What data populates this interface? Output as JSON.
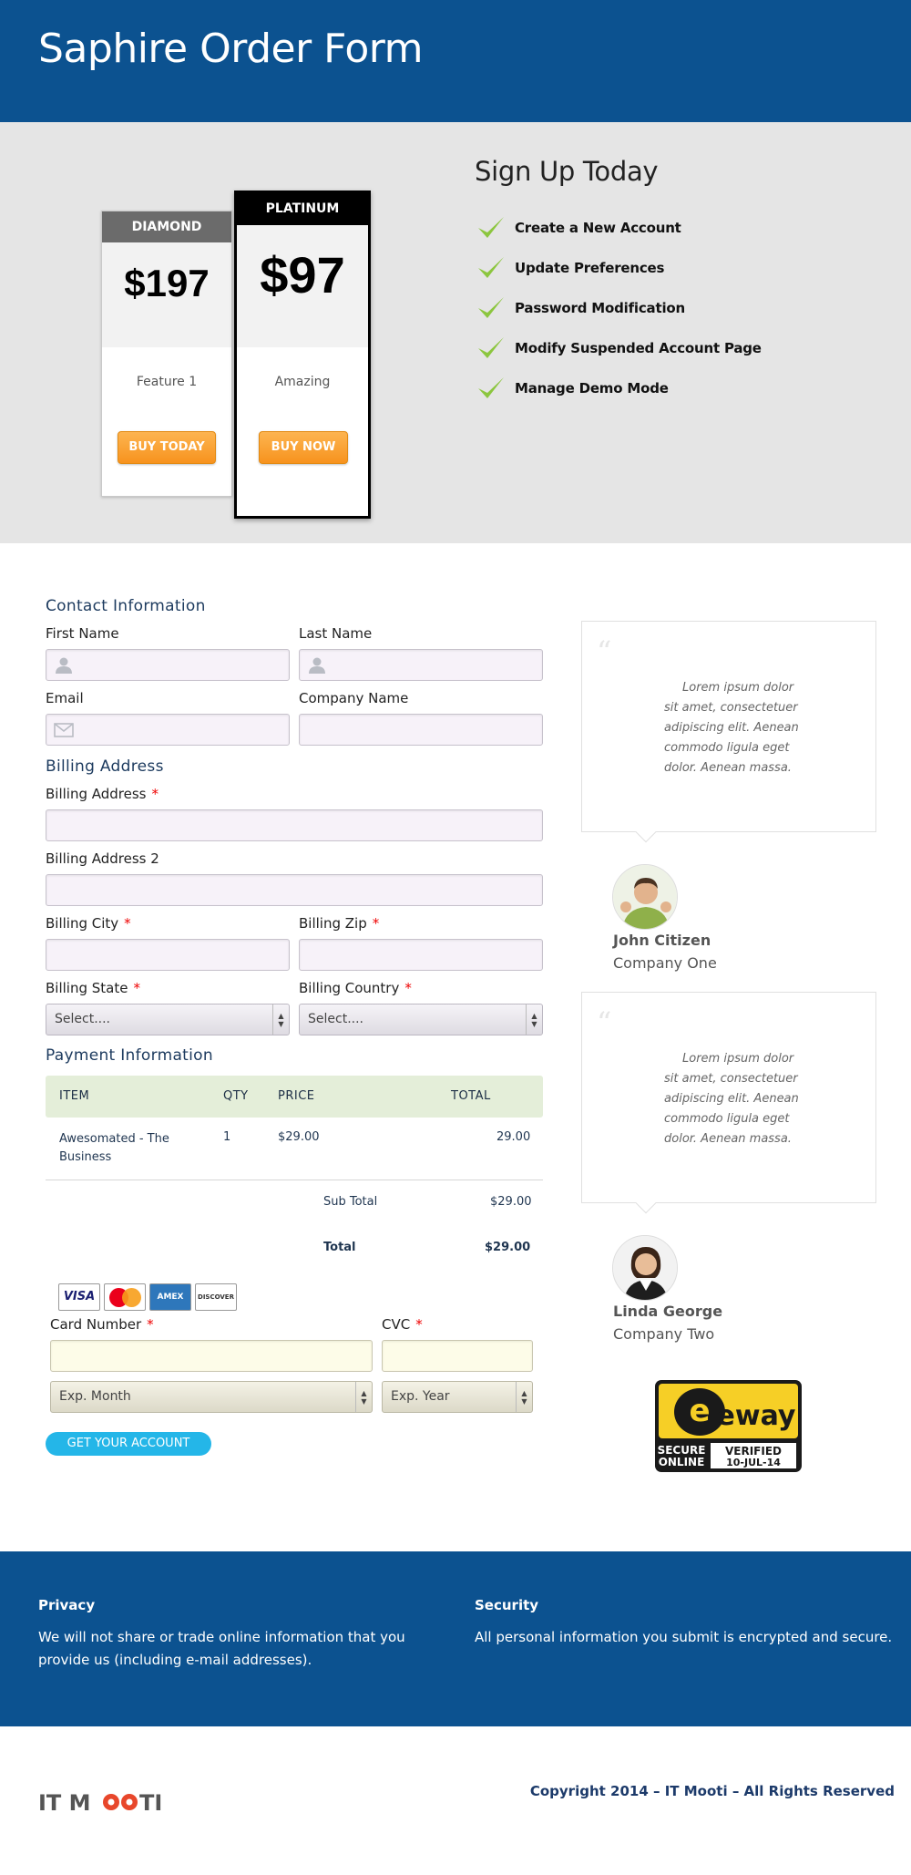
{
  "header": {
    "title": "Saphire Order Form"
  },
  "plans": [
    {
      "name": "DIAMOND",
      "price": "$197",
      "feature": "Feature 1",
      "button": "BUY TODAY"
    },
    {
      "name": "PLATINUM",
      "price": "$97",
      "feature": "Amazing",
      "button": "BUY NOW"
    }
  ],
  "signup": {
    "title": "Sign Up Today",
    "items": [
      "Create a New Account",
      "Update Preferences",
      "Password Modification",
      "Modify Suspended Account Page",
      "Manage Demo Mode"
    ]
  },
  "contact": {
    "title": "Contact Information",
    "first_name_label": "First Name",
    "last_name_label": "Last Name",
    "email_label": "Email",
    "company_label": "Company Name"
  },
  "billing": {
    "title": "Billing Address",
    "address_label": "Billing Address",
    "address2_label": "Billing Address 2",
    "city_label": "Billing City",
    "zip_label": "Billing Zip",
    "state_label": "Billing State",
    "country_label": "Billing Country",
    "state_value": "Select....",
    "country_value": "Select....",
    "required_mark": "*"
  },
  "payment": {
    "title": "Payment Information",
    "headers": {
      "item": "ITEM",
      "qty": "QTY",
      "price": "PRICE",
      "total": "TOTAL"
    },
    "rows": [
      {
        "item_line1": "Awesomated - The",
        "item_line2": "Business",
        "qty": "1",
        "price": "$29.00",
        "total": "29.00"
      }
    ],
    "subtotal_label": "Sub Total",
    "subtotal_value": "$29.00",
    "total_label": "Total",
    "total_value": "$29.00",
    "cards": [
      "VISA",
      "MC",
      "AMEX",
      "DISCOVER"
    ],
    "card_number_label": "Card Number",
    "cvc_label": "CVC",
    "exp_month": "Exp. Month",
    "exp_year": "Exp. Year",
    "submit": "GET YOUR ACCOUNT"
  },
  "testimonials": [
    {
      "text": "Lorem ipsum dolor sit amet, consectetuer adipiscing elit. Aenean commodo ligula eget dolor. Aenean massa.",
      "name": "John Citizen",
      "company": "Company One"
    },
    {
      "text": "Lorem ipsum dolor sit amet, consectetuer adipiscing elit. Aenean commodo ligula eget dolor. Aenean massa.",
      "name": "Linda George",
      "company": "Company Two"
    }
  ],
  "eway": {
    "brand": "eway",
    "secure1": "SECURE",
    "secure2": "ONLINE",
    "verified": "VERIFIED",
    "date": "10-JUL-14"
  },
  "footer": {
    "privacy_title": "Privacy",
    "privacy_text": "We will not share or trade online information that you provide us (including e-mail addresses).",
    "security_title": "Security",
    "security_text": "All personal information you submit is encrypted and secure."
  },
  "bottom": {
    "logo_text": "IT MOOTI",
    "copyright": "Copyright 2014 – IT Mooti – All Rights Reserved"
  },
  "colors": {
    "brand": "#0c5290",
    "accent_orange": "#f7931e",
    "submit": "#24b6e8",
    "check_green": "#8cc63f"
  }
}
